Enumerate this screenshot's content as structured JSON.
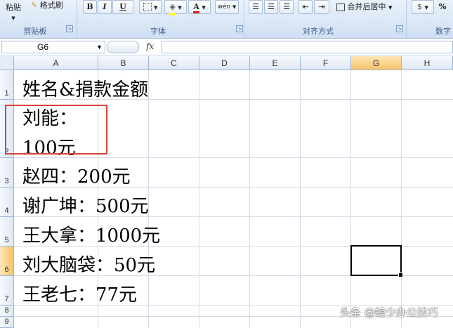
{
  "ribbon": {
    "paste_label": "粘贴",
    "format_painter_label": "格式刷",
    "bold": "B",
    "italic": "I",
    "underline": "U",
    "font_color_glyph": "A",
    "phonetic_glyph": "wén",
    "merge_center_label": "合并后居中",
    "percent_glyph": "%",
    "groups": {
      "clipboard": "剪贴板",
      "font": "字体",
      "alignment": "对齐方式",
      "number": "数字"
    }
  },
  "formula_bar": {
    "name_box": "G6",
    "fx": "fx",
    "content": ""
  },
  "columns": [
    "A",
    "B",
    "C",
    "D",
    "E",
    "F",
    "G",
    "H"
  ],
  "rows": [
    "1",
    "2",
    "3",
    "4",
    "5",
    "6",
    "7",
    "8",
    "9"
  ],
  "cells": {
    "a1": "姓名&捐款金额",
    "a2_line1": "刘能：",
    "a2_line2": "100元",
    "a3": "赵四：200元",
    "a4": "谢广坤：500元",
    "a5": "王大拿：1000元",
    "a6": "刘大脑袋：50元",
    "a7": "王老七：77元"
  },
  "selection": {
    "active_cell": "G6",
    "active_column": "G",
    "active_row": "6"
  },
  "annotation_color": "#d9423b",
  "watermark": "头条 @螃少办公技巧"
}
